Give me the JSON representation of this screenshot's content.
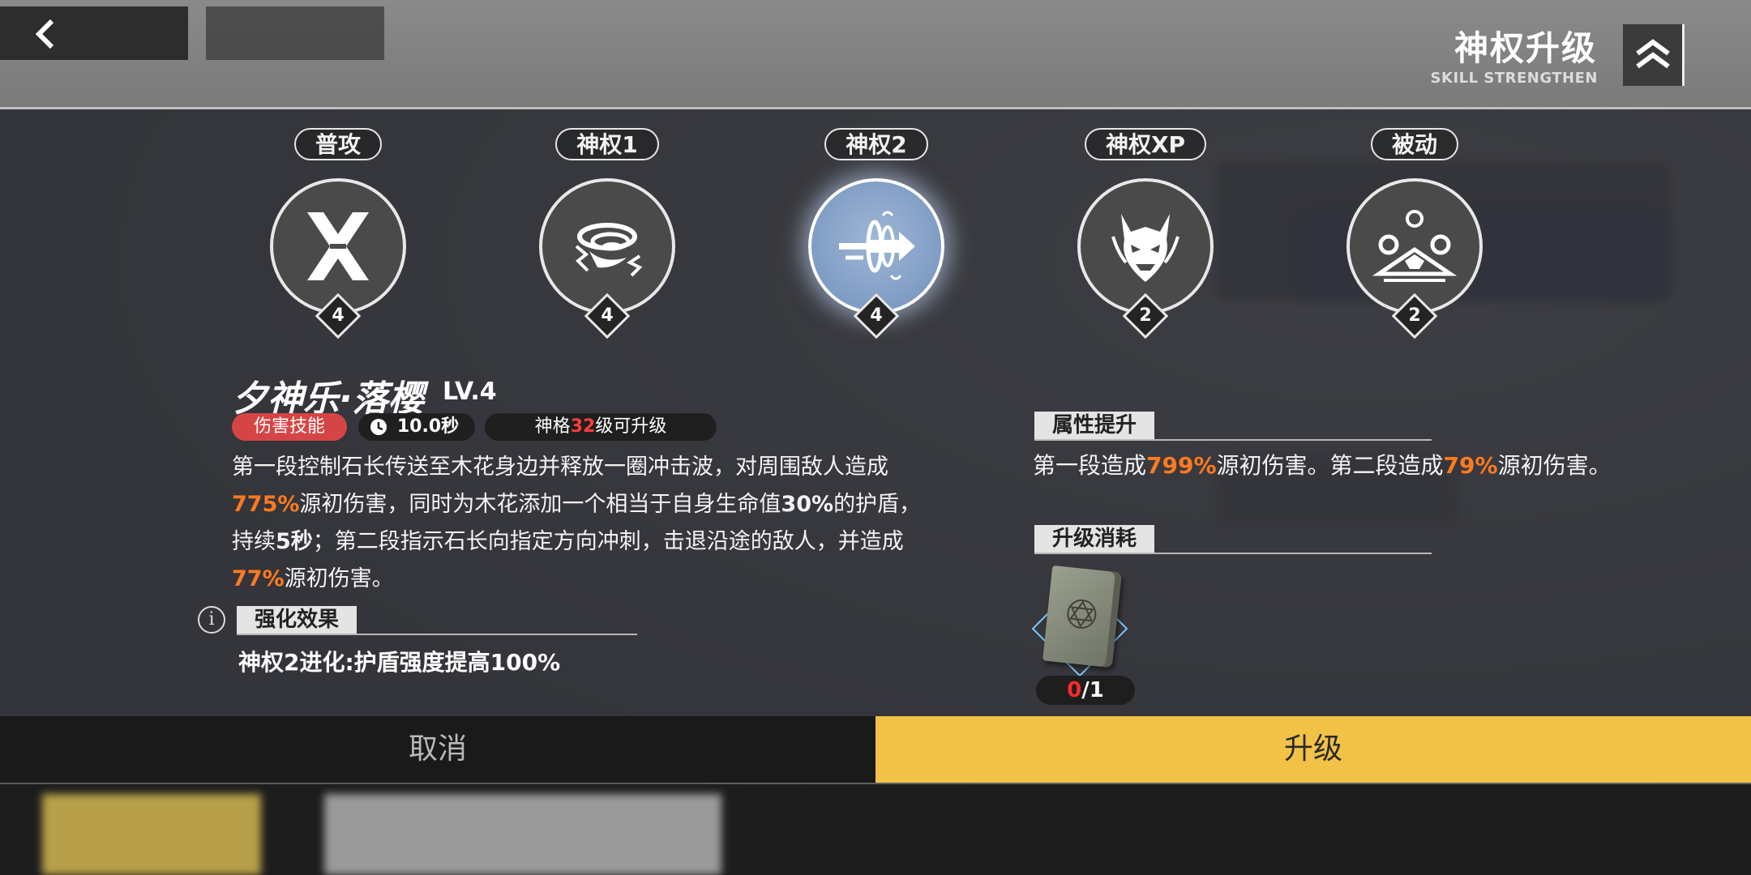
{
  "header": {
    "title": "神权升级",
    "subtitle": "SKILL STRENGTHEN"
  },
  "skills": [
    {
      "label": "普攻",
      "level": "4",
      "icon": "slash-icon",
      "active": false
    },
    {
      "label": "神权1",
      "level": "4",
      "icon": "vortex-icon",
      "active": false
    },
    {
      "label": "神权2",
      "level": "4",
      "icon": "dash-icon",
      "active": true
    },
    {
      "label": "神权XP",
      "level": "2",
      "icon": "oni-mask-icon",
      "active": false
    },
    {
      "label": "被动",
      "level": "2",
      "icon": "orbs-icon",
      "active": false
    }
  ],
  "detail": {
    "name": "夕神乐·落樱",
    "level": "LV.4",
    "tag_type": "伤害技能",
    "cooldown": "10.0秒",
    "requirement_prefix": "神格",
    "requirement_level": "32",
    "requirement_suffix": "级可升级",
    "desc_1": "第一段控制石长传送至木花身边并释放一圈冲击波，对周围敌人造成",
    "desc_2": "775%",
    "desc_3": "源初伤害，同时为木花添加一个相当于自身生命值",
    "desc_4": "30%",
    "desc_5": "的护盾，持续",
    "desc_6": "5秒",
    "desc_7": "；第二段指示石长向指定方向冲刺，击退沿途的敌人，并造成",
    "desc_8": "77%",
    "desc_9": "源初伤害。"
  },
  "enhance": {
    "heading": "强化效果",
    "text": "神权2进化:护盾强度提高100%"
  },
  "attribute": {
    "heading": "属性提升",
    "t1": "第一段造成",
    "v1": "799%",
    "t2": "源初伤害。第二段造成",
    "v2": "79%",
    "t3": "源初伤害。"
  },
  "cost": {
    "heading": "升级消耗",
    "item_icon": "skill-book-icon",
    "have": "0",
    "need": "/1"
  },
  "buttons": {
    "cancel": "取消",
    "upgrade": "升级"
  },
  "colors": {
    "highlight": "#ff7a1f",
    "danger": "#d64545",
    "confirm": "#f2c247"
  }
}
